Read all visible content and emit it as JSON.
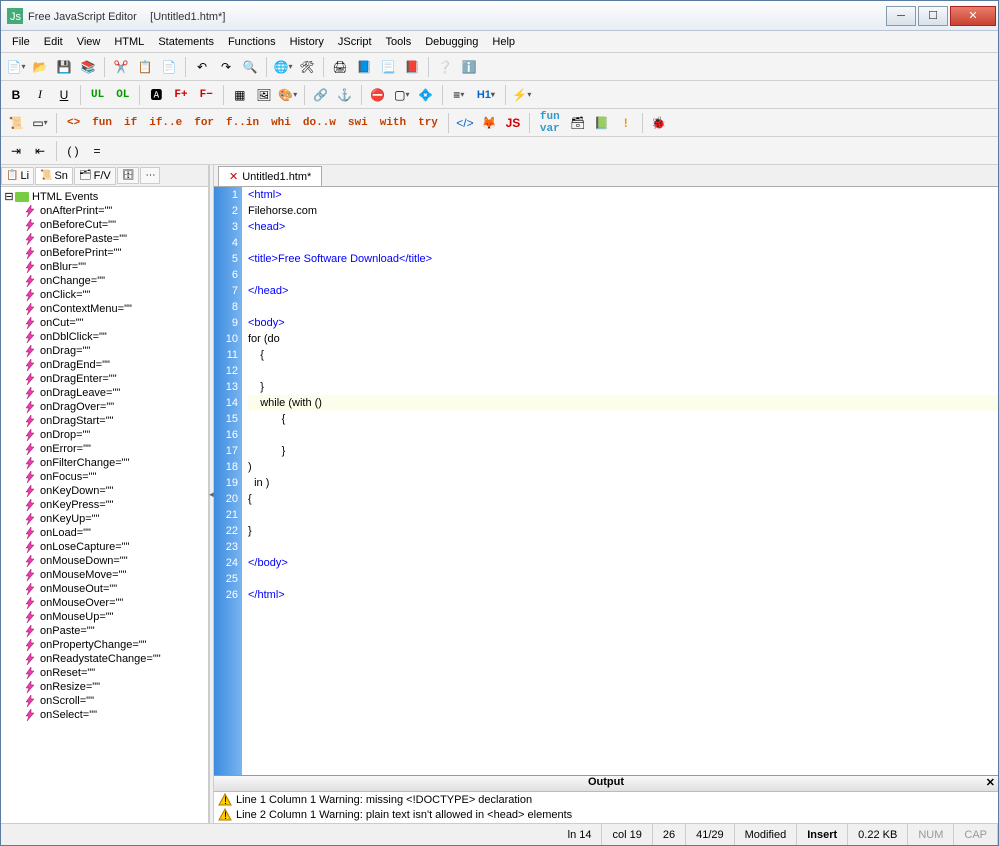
{
  "window": {
    "app_name": "Free JavaScript Editor",
    "doc_name": "[Untitled1.htm*]"
  },
  "menu": [
    "File",
    "Edit",
    "View",
    "HTML",
    "Statements",
    "Functions",
    "History",
    "JScript",
    "Tools",
    "Debugging",
    "Help"
  ],
  "toolbar2": {
    "bold": "B",
    "italic": "I",
    "underline": "U",
    "ul": "UL",
    "ol": "OL",
    "font_plus": "F+",
    "font_minus": "F−",
    "h1": "H1"
  },
  "toolbar4_keywords": [
    "<>",
    "fun",
    "if",
    "if..e",
    "for",
    "f..in",
    "whi",
    "do..w",
    "swi",
    "with",
    "try"
  ],
  "side_tabs": {
    "li": "Li",
    "sn": "Sn",
    "fv": "F/V"
  },
  "tree_root": "HTML Events",
  "tree_items": [
    "onAfterPrint=\"\"",
    "onBeforeCut=\"\"",
    "onBeforePaste=\"\"",
    "onBeforePrint=\"\"",
    "onBlur=\"\"",
    "onChange=\"\"",
    "onClick=\"\"",
    "onContextMenu=\"\"",
    "onCut=\"\"",
    "onDblClick=\"\"",
    "onDrag=\"\"",
    "onDragEnd=\"\"",
    "onDragEnter=\"\"",
    "onDragLeave=\"\"",
    "onDragOver=\"\"",
    "onDragStart=\"\"",
    "onDrop=\"\"",
    "onError=\"\"",
    "onFilterChange=\"\"",
    "onFocus=\"\"",
    "onKeyDown=\"\"",
    "onKeyPress=\"\"",
    "onKeyUp=\"\"",
    "onLoad=\"\"",
    "onLoseCapture=\"\"",
    "onMouseDown=\"\"",
    "onMouseMove=\"\"",
    "onMouseOut=\"\"",
    "onMouseOver=\"\"",
    "onMouseUp=\"\"",
    "onPaste=\"\"",
    "onPropertyChange=\"\"",
    "onReadystateChange=\"\"",
    "onReset=\"\"",
    "onResize=\"\"",
    "onScroll=\"\"",
    "onSelect=\"\""
  ],
  "editor_tab": "Untitled1.htm*",
  "code_lines": [
    {
      "n": 1,
      "cls": "t-blue",
      "text": "<html>"
    },
    {
      "n": 2,
      "cls": "t-black",
      "text": "Filehorse.com"
    },
    {
      "n": 3,
      "cls": "t-blue",
      "text": "<head>"
    },
    {
      "n": 4,
      "cls": "",
      "text": ""
    },
    {
      "n": 5,
      "cls": "t-blue",
      "text": "<title>Free Software Download</title>"
    },
    {
      "n": 6,
      "cls": "",
      "text": ""
    },
    {
      "n": 7,
      "cls": "t-blue",
      "text": "</head>"
    },
    {
      "n": 8,
      "cls": "",
      "text": ""
    },
    {
      "n": 9,
      "cls": "t-blue",
      "text": "<body>"
    },
    {
      "n": 10,
      "cls": "t-black",
      "text": "for (do"
    },
    {
      "n": 11,
      "cls": "t-black",
      "text": "    {"
    },
    {
      "n": 12,
      "cls": "",
      "text": ""
    },
    {
      "n": 13,
      "cls": "t-black",
      "text": "    }"
    },
    {
      "n": 14,
      "cls": "t-black",
      "text": "    while (with ()",
      "hl": true
    },
    {
      "n": 15,
      "cls": "t-black",
      "text": "           {"
    },
    {
      "n": 16,
      "cls": "",
      "text": ""
    },
    {
      "n": 17,
      "cls": "t-black",
      "text": "           }"
    },
    {
      "n": 18,
      "cls": "t-black",
      "text": ")"
    },
    {
      "n": 19,
      "cls": "t-black",
      "text": "  in )"
    },
    {
      "n": 20,
      "cls": "t-black",
      "text": "{"
    },
    {
      "n": 21,
      "cls": "",
      "text": ""
    },
    {
      "n": 22,
      "cls": "t-black",
      "text": "}"
    },
    {
      "n": 23,
      "cls": "",
      "text": ""
    },
    {
      "n": 24,
      "cls": "t-blue",
      "text": "</body>"
    },
    {
      "n": 25,
      "cls": "",
      "text": ""
    },
    {
      "n": 26,
      "cls": "t-blue",
      "text": "</html>"
    }
  ],
  "output": {
    "title": "Output",
    "lines": [
      "Line 1 Column 1  Warning: missing <!DOCTYPE> declaration",
      "Line 2 Column 1  Warning: plain text isn't allowed in <head> elements"
    ]
  },
  "status": {
    "ln": "ln 14",
    "col": "col 19",
    "sel": "26",
    "pos": "41/29",
    "modified": "Modified",
    "insert": "Insert",
    "size": "0.22 KB",
    "num": "NUM",
    "cap": "CAP"
  }
}
